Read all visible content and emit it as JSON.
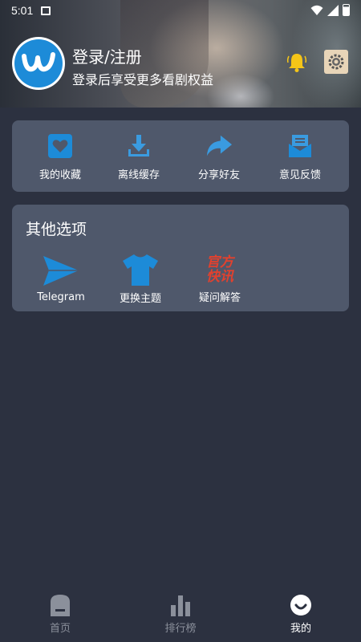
{
  "status_bar": {
    "time": "5:01"
  },
  "header": {
    "login_title": "登录/注册",
    "login_subtitle": "登录后享受更多看剧权益"
  },
  "quick_actions": [
    {
      "label": "我的收藏",
      "icon": "heart-box-icon"
    },
    {
      "label": "离线缓存",
      "icon": "download-icon"
    },
    {
      "label": "分享好友",
      "icon": "share-arrow-icon"
    },
    {
      "label": "意见反馈",
      "icon": "mail-icon"
    }
  ],
  "other_options": {
    "title": "其他选项",
    "items": [
      {
        "label": "Telegram",
        "icon": "telegram-icon"
      },
      {
        "label": "更换主题",
        "icon": "tshirt-icon"
      },
      {
        "label": "疑问解答",
        "icon": "official-news-icon",
        "icon_text_top": "官方",
        "icon_text_bottom": "快讯"
      }
    ]
  },
  "bottom_nav": [
    {
      "label": "首页",
      "icon": "home-icon",
      "active": false
    },
    {
      "label": "排行榜",
      "icon": "chart-bars-icon",
      "active": false
    },
    {
      "label": "我的",
      "icon": "smile-icon",
      "active": true
    }
  ],
  "colors": {
    "background": "#2c3140",
    "card": "#4f586b",
    "accent_blue": "#1d8bd8",
    "news_red": "#e2412e",
    "bell_yellow": "#f5c518",
    "nav_inactive": "#8b909b"
  }
}
